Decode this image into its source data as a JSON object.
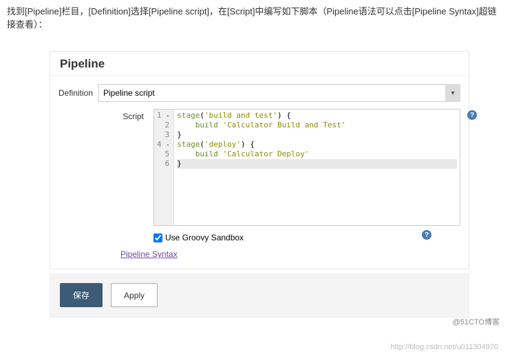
{
  "intro": {
    "text": "找到[Pipeline]栏目，[Definition]选择[Pipeline script]，在[Script]中编写如下脚本（Pipeline语法可以点击[Pipeline Syntax]超链接查看）："
  },
  "panel": {
    "title": "Pipeline",
    "definition_label": "Definition",
    "definition_value": "Pipeline script",
    "script_label": "Script",
    "code": {
      "lines": [
        {
          "n": "1",
          "fold": "▾",
          "indent": "",
          "parts": [
            {
              "t": "kw",
              "v": "stage"
            },
            {
              "t": "",
              "v": "("
            },
            {
              "t": "str",
              "v": "'build and test'"
            },
            {
              "t": "",
              "v": ") {"
            }
          ]
        },
        {
          "n": "2",
          "fold": "",
          "indent": "    ",
          "parts": [
            {
              "t": "kw",
              "v": "build"
            },
            {
              "t": "",
              "v": " "
            },
            {
              "t": "str",
              "v": "'Calculator Build and Test'"
            }
          ]
        },
        {
          "n": "3",
          "fold": "",
          "indent": "",
          "parts": [
            {
              "t": "",
              "v": "}"
            }
          ]
        },
        {
          "n": "4",
          "fold": "▾",
          "indent": "",
          "parts": [
            {
              "t": "kw",
              "v": "stage"
            },
            {
              "t": "",
              "v": "("
            },
            {
              "t": "str",
              "v": "'deploy'"
            },
            {
              "t": "",
              "v": ") {"
            }
          ]
        },
        {
          "n": "5",
          "fold": "",
          "indent": "    ",
          "parts": [
            {
              "t": "kw",
              "v": "build"
            },
            {
              "t": "",
              "v": " "
            },
            {
              "t": "str",
              "v": "'Calculator Deploy'"
            }
          ]
        },
        {
          "n": "6",
          "fold": "",
          "indent": "",
          "parts": [
            {
              "t": "",
              "v": "}"
            }
          ],
          "current": true
        }
      ]
    },
    "sandbox_label": "Use Groovy Sandbox",
    "sandbox_checked": true,
    "syntax_link": "Pipeline Syntax",
    "help_glyph": "?"
  },
  "buttons": {
    "save": "保存",
    "apply": "Apply"
  },
  "watermark": {
    "line1": "http://blog.csdn.net/u011304970",
    "line2": "@51CTO博客"
  }
}
